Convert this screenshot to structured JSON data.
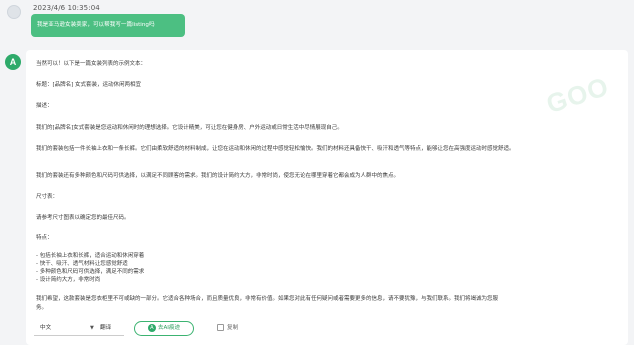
{
  "user": {
    "timestamp": "2023/4/6 10:35:04",
    "message": "我是亚马逊女装卖家，可以帮我写一篇listing吗"
  },
  "assistant": {
    "avatar_letter": "A",
    "watermark": "GOO",
    "lines": [
      "当然可以！以下是一篇女装列表的示例文本：",
      "标题：[品牌名] 女式套装，运动休闲两相宜",
      "描述：",
      "我们的[品牌名]女式套装是您运动和休闲时的理想选择。它设计精美，可让您在健身房、户外运动或日常生活中尽情展现自己。",
      "我们的套装包括一件长袖上衣和一条长裤。它们由柔软舒适的材料制成，让您在运动和休闲的过程中感觉轻松愉快。我们的材料还具备快干、吸汗和透气等特点，能够让您在高强度运动时感觉舒适。",
      "我们的套装还有多种颜色和尺码可供选择，以满足不同顾客的需求。我们的设计简约大方，非常时尚，使您无论在哪里穿着它都会成为人群中的焦点。",
      "尺寸表：",
      "请参考尺寸图表以确定您的最佳尺码。",
      "特点：",
      "- 包括长袖上衣和长裤，适合运动和休闲穿着",
      "- 快干、吸汗、透气材料让您感觉舒适",
      "- 多种颜色和尺码可供选择，满足不同的需求",
      "- 设计简约大方，非常时尚",
      "我们希望，这款套装是您衣柜里不可或缺的一部分。它适合各种场合，而且质量优良，非常有价值。如果您对此有任何疑问或者需要更多的信息，请不要犹豫，与我们联系。我们将竭诚为您服",
      "务。"
    ]
  },
  "toolbar": {
    "language": "中文",
    "chevron": "▼",
    "translate": "翻译",
    "ai_polish": "去AI痕迹",
    "ai_polish_icon": "A",
    "copy": "复制"
  }
}
